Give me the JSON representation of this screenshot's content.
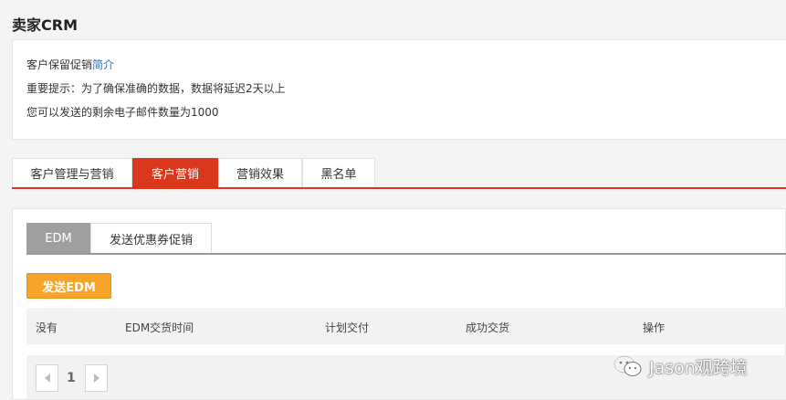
{
  "page": {
    "title": "卖家CRM"
  },
  "info": {
    "line1_text": "客户保留促销",
    "line1_link": "简介",
    "line2": "重要提示：为了确保准确的数据，数据将延迟2天以上",
    "line3": "您可以发送的剩余电子邮件数量为1000"
  },
  "main_tabs": [
    {
      "label": "客户管理与营销",
      "active": false
    },
    {
      "label": "客户营销",
      "active": true
    },
    {
      "label": "营销效果",
      "active": false
    },
    {
      "label": "黑名单",
      "active": false
    }
  ],
  "sub_tabs": [
    {
      "label": "EDM",
      "active": true
    },
    {
      "label": "发送优惠券促销",
      "active": false
    }
  ],
  "send_button": "发送EDM",
  "table": {
    "headers": [
      "没有",
      "EDM交货时间",
      "计划交付",
      "成功交货",
      "操作"
    ]
  },
  "pagination": {
    "current_page": "1"
  },
  "watermark": {
    "text": "Jason观跨境",
    "icon": "wechat-icon"
  },
  "colors": {
    "accent": "#d8391c",
    "button": "#f7a42b",
    "link": "#2f6fba",
    "subtab_active": "#a0a0a0"
  }
}
